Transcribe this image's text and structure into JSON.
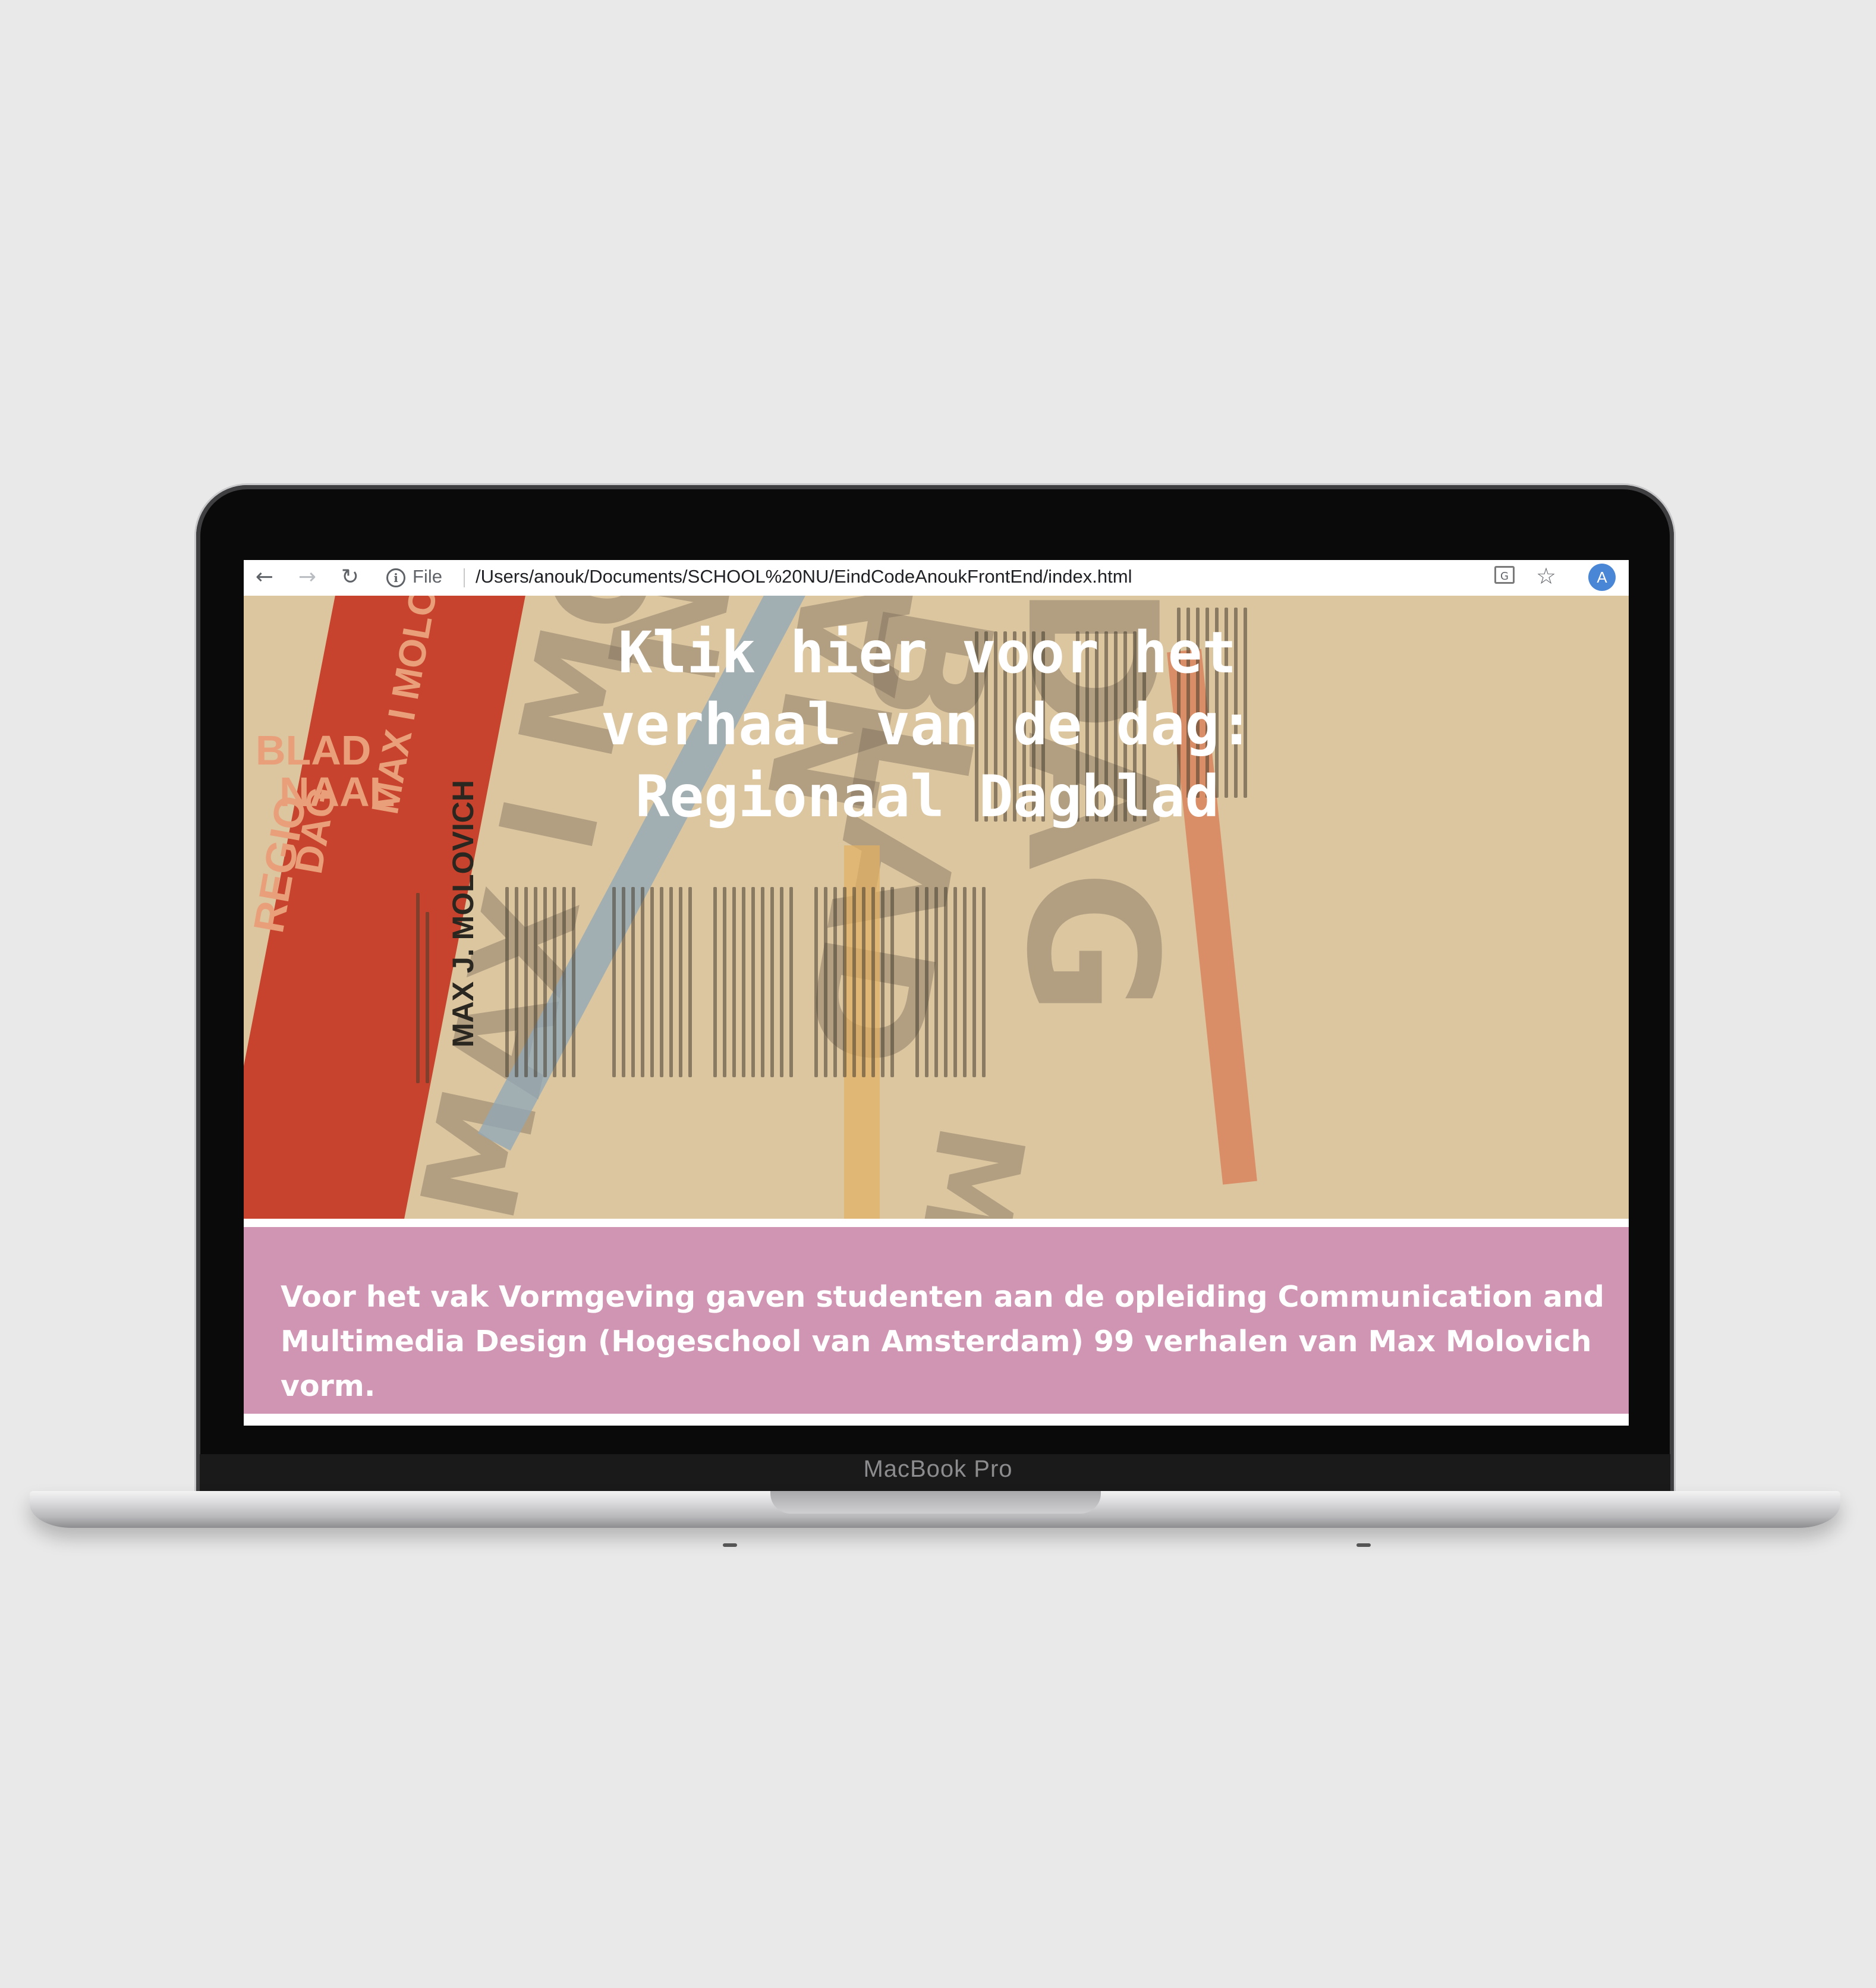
{
  "browser": {
    "back_icon": "arrow-left-icon",
    "forward_icon": "arrow-right-icon",
    "reload_icon": "reload-icon",
    "info_icon": "info-icon",
    "scheme_label": "File",
    "url": "/Users/anouk/Documents/SCHOOL%20NU/EindCodeAnoukFrontEnd/index.html",
    "translate_icon": "translate-icon",
    "bookmark_icon": "star-icon",
    "profile_initial": "A"
  },
  "hero": {
    "title": "Klik hier voor het verhaal van de dag: Regionaal Dagblad",
    "poster_words": {
      "blad": "BLAD",
      "dag": "DAG",
      "naal": "NAAL",
      "regio": "REGIO",
      "max_molovich": "MAX I MOLOV",
      "author": "MAX J. MOLOVICH"
    },
    "colors": {
      "background": "#dcc6a0",
      "red": "#c8432d",
      "blue_stripe": "#8fa7b8",
      "orange_stripe": "#d9845a",
      "yellow_stripe": "#e2b063"
    }
  },
  "info": {
    "text": "Voor het vak Vormgeving gaven studenten aan de opleiding Communication and Multimedia Design (Hogeschool van Amsterdam) 99 verhalen van Max Molovich vorm.",
    "background": "#cf95b2"
  },
  "device": {
    "brand": "MacBook Pro"
  }
}
